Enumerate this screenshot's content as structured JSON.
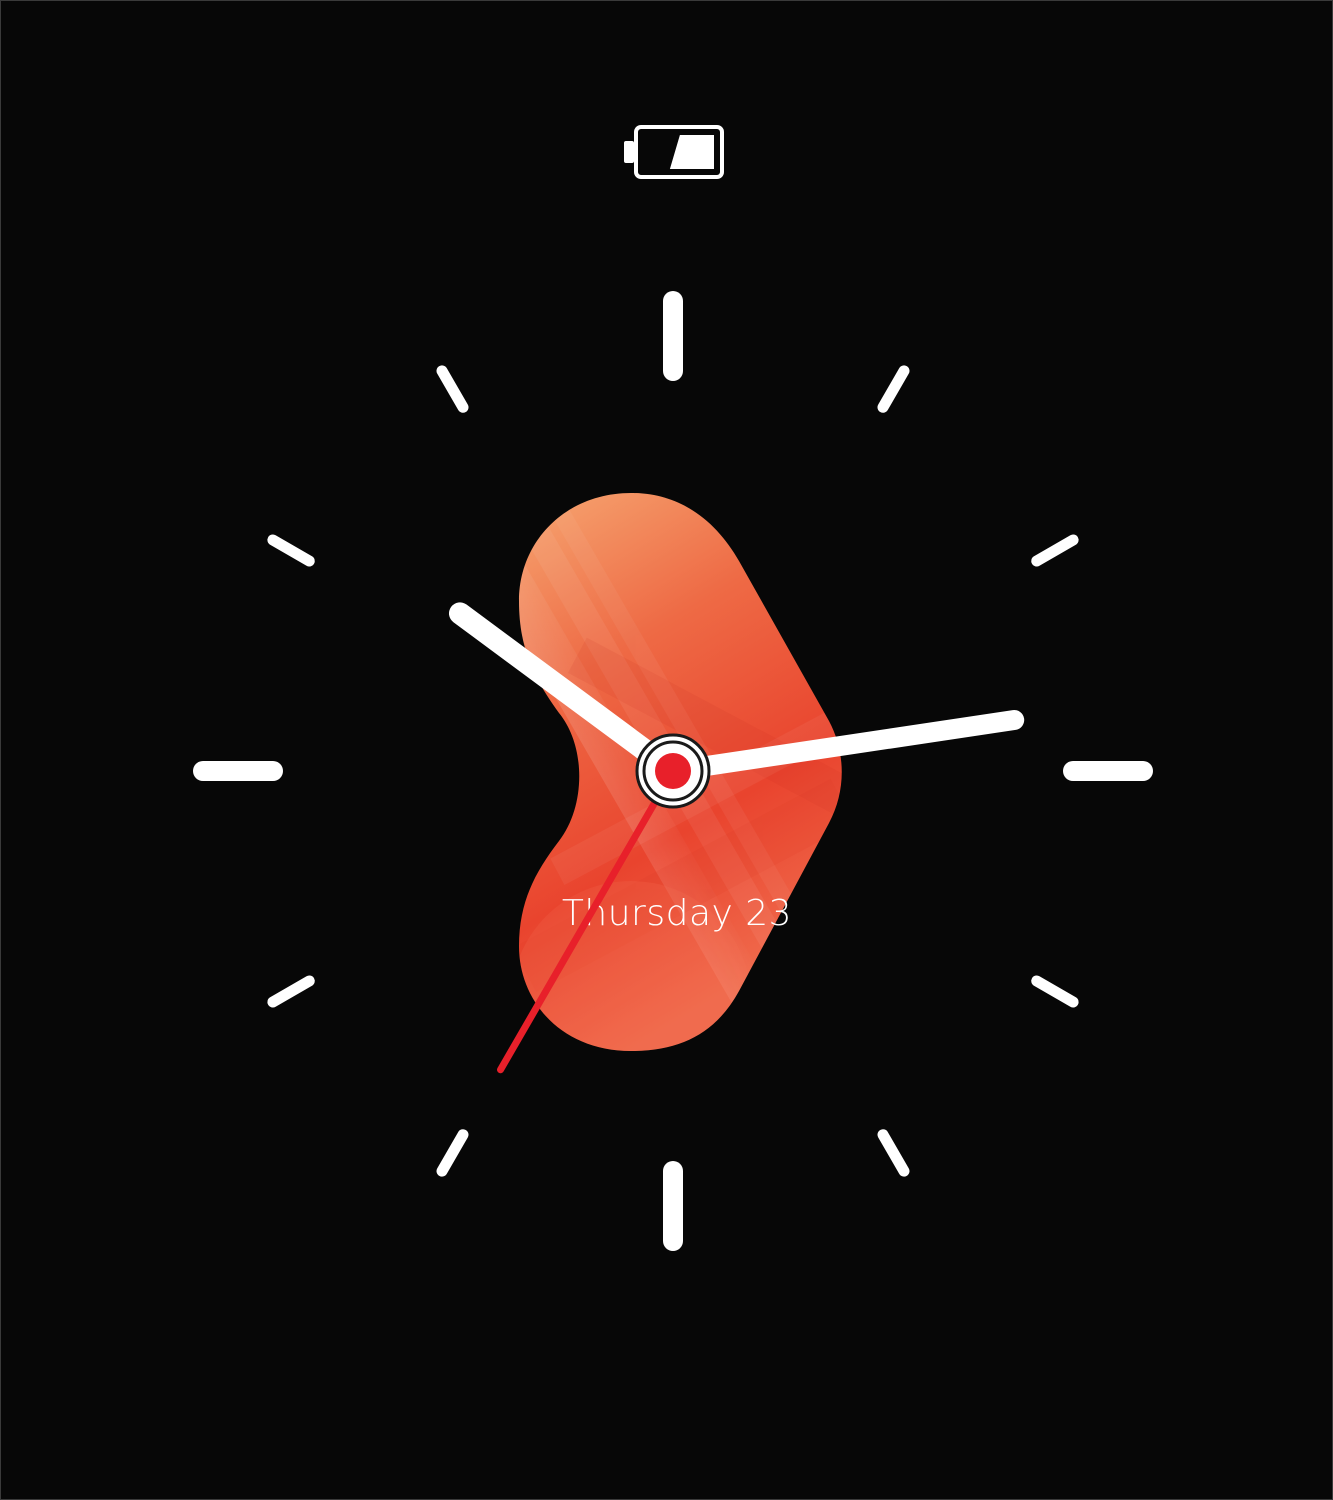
{
  "watch_face": {
    "date_label": "Thursday 23",
    "battery": {
      "icon": "battery-icon",
      "level": 0.7
    },
    "time": {
      "hours": 10,
      "minutes": 13,
      "seconds": 35
    },
    "colors": {
      "background": "#070707",
      "accent": "#e8202a",
      "hands": "#ffffff",
      "blob_top": "#f4a06c",
      "blob_bottom": "#e8452f"
    }
  }
}
